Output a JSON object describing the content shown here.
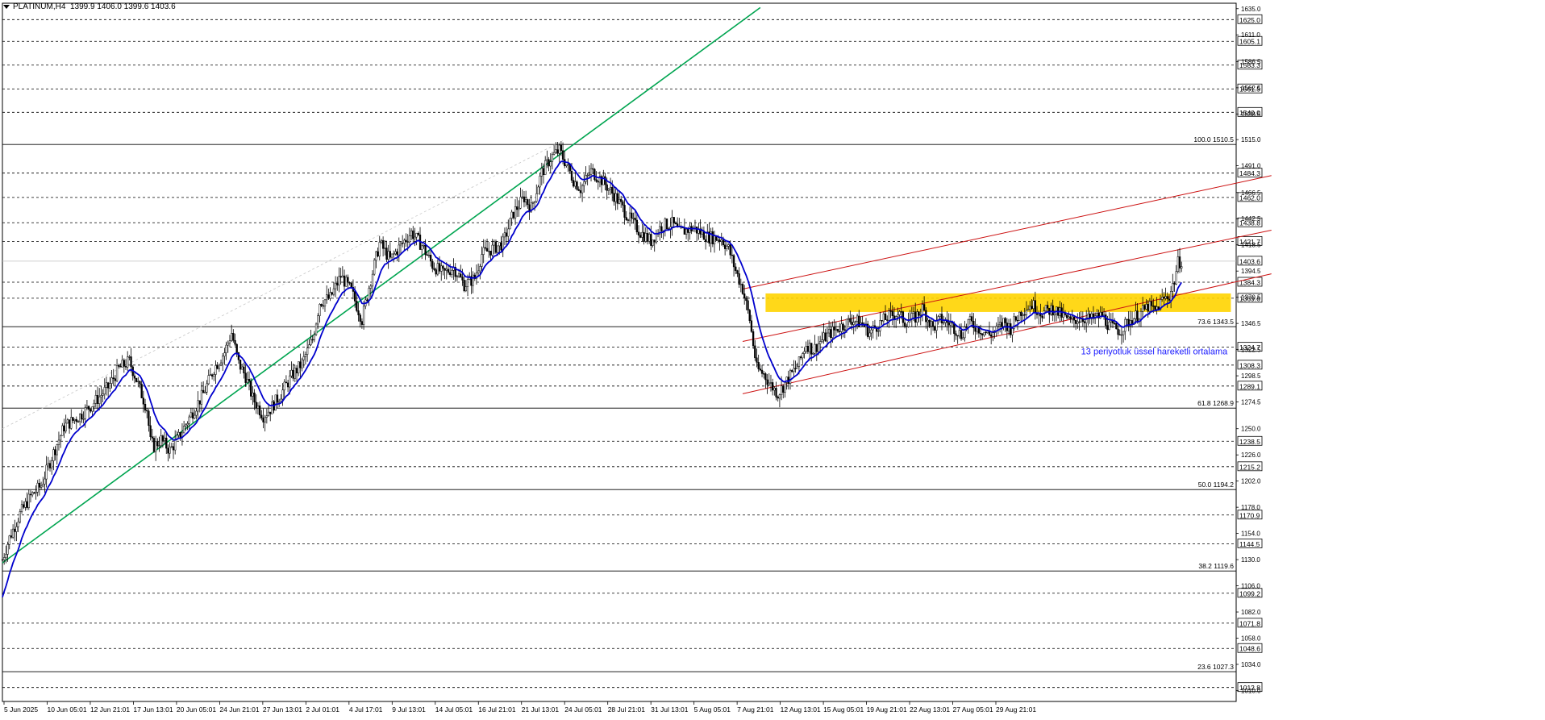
{
  "header": {
    "symbol": "PLATINUM,H4",
    "ohlc": "1399.9 1406.0 1399.6 1403.6"
  },
  "colors": {
    "background": "#ffffff",
    "candles": "#000000",
    "ema": "#0000cd",
    "support_trendline": "#00a550",
    "channel": "#cc1111",
    "zone": "#ffd400",
    "annotation": "#1a1aff",
    "grid": "#000000"
  },
  "chart_data": {
    "type": "candlestick",
    "title": "",
    "ylim": [
      1000,
      1640
    ],
    "x_ticks": [
      "5 Jun 2025",
      "10 Jun 05:01",
      "12 Jun 21:01",
      "17 Jun 13:01",
      "20 Jun 05:01",
      "24 Jun 21:01",
      "27 Jun 13:01",
      "2 Jul 01:01",
      "4 Jul 17:01",
      "9 Jul 13:01",
      "14 Jul 05:01",
      "16 Jul 21:01",
      "21 Jul 13:01",
      "24 Jul 05:01",
      "28 Jul 21:01",
      "31 Jul 13:01",
      "5 Aug 05:01",
      "7 Aug 21:01",
      "12 Aug 13:01",
      "15 Aug 05:01",
      "19 Aug 21:01",
      "22 Aug 13:01",
      "27 Aug 05:01",
      "29 Aug 21:01"
    ],
    "y_ticks": [
      "1635.0",
      "1611.0",
      "1586.5",
      "1562.5",
      "1538.5",
      "1515.0",
      "1491.0",
      "1466.5",
      "1442.5",
      "1418.5",
      "1394.5",
      "1370.5",
      "1346.5",
      "1322.5",
      "1298.5",
      "1274.5",
      "1250.0",
      "1226.0",
      "1202.0",
      "1178.0",
      "1154.0",
      "1130.0",
      "1106.0",
      "1082.0",
      "1058.0",
      "1034.0",
      "1010.0"
    ],
    "level_lines": [
      {
        "label": "1625.0",
        "value": 1625.0
      },
      {
        "label": "1605.1",
        "value": 1605.1
      },
      {
        "label": "1583.3",
        "value": 1583.3
      },
      {
        "label": "1561.5",
        "value": 1561.5
      },
      {
        "label": "1540.0",
        "value": 1540.0
      },
      {
        "label": "1484.3",
        "value": 1484.3
      },
      {
        "label": "1462.0",
        "value": 1462.0
      },
      {
        "label": "1438.8",
        "value": 1438.8
      },
      {
        "label": "1421.7",
        "value": 1421.7
      },
      {
        "label": "1384.3",
        "value": 1384.3
      },
      {
        "label": "1369.6",
        "value": 1369.6
      },
      {
        "label": "1324.7",
        "value": 1324.7
      },
      {
        "label": "1308.3",
        "value": 1308.3
      },
      {
        "label": "1289.1",
        "value": 1289.1
      },
      {
        "label": "1238.5",
        "value": 1238.5
      },
      {
        "label": "1215.2",
        "value": 1215.2
      },
      {
        "label": "1170.9",
        "value": 1170.9
      },
      {
        "label": "1144.5",
        "value": 1144.5
      },
      {
        "label": "1099.2",
        "value": 1099.2
      },
      {
        "label": "1071.8",
        "value": 1071.8
      },
      {
        "label": "1048.6",
        "value": 1048.6
      },
      {
        "label": "1012.8",
        "value": 1012.8
      }
    ],
    "current_price": {
      "label": "1403.6",
      "value": 1403.6
    },
    "fibonacci": [
      {
        "label": "100.0 1510.5",
        "value": 1510.5
      },
      {
        "label": "73.6 1343.5",
        "value": 1343.5
      },
      {
        "label": "61.8 1268.9",
        "value": 1268.9
      },
      {
        "label": "50.0 1194.2",
        "value": 1194.2
      },
      {
        "label": "38.2 1119.6",
        "value": 1119.6
      },
      {
        "label": "23.6 1027.3",
        "value": 1027.3
      }
    ],
    "series": [
      {
        "name": "13 periyotluk üssel hareketli ortalama",
        "type": "ema",
        "period": 13
      }
    ],
    "candles_close_path": [
      [
        0,
        1130
      ],
      [
        4,
        1150
      ],
      [
        10,
        1172
      ],
      [
        16,
        1188
      ],
      [
        22,
        1198
      ],
      [
        28,
        1224
      ],
      [
        35,
        1252
      ],
      [
        44,
        1262
      ],
      [
        52,
        1274
      ],
      [
        60,
        1288
      ],
      [
        66,
        1305
      ],
      [
        72,
        1312
      ],
      [
        76,
        1295
      ],
      [
        82,
        1268
      ],
      [
        84,
        1238
      ],
      [
        86,
        1234
      ],
      [
        90,
        1240
      ],
      [
        95,
        1230
      ],
      [
        100,
        1242
      ],
      [
        106,
        1260
      ],
      [
        114,
        1282
      ],
      [
        120,
        1305
      ],
      [
        126,
        1320
      ],
      [
        130,
        1338
      ],
      [
        134,
        1310
      ],
      [
        138,
        1298
      ],
      [
        142,
        1278
      ],
      [
        148,
        1262
      ],
      [
        152,
        1268
      ],
      [
        158,
        1282
      ],
      [
        164,
        1298
      ],
      [
        170,
        1310
      ],
      [
        176,
        1332
      ],
      [
        180,
        1366
      ],
      [
        186,
        1370
      ],
      [
        192,
        1390
      ],
      [
        198,
        1376
      ],
      [
        204,
        1350
      ],
      [
        208,
        1380
      ],
      [
        214,
        1420
      ],
      [
        220,
        1405
      ],
      [
        226,
        1418
      ],
      [
        232,
        1430
      ],
      [
        238,
        1418
      ],
      [
        244,
        1400
      ],
      [
        250,
        1392
      ],
      [
        256,
        1398
      ],
      [
        262,
        1382
      ],
      [
        268,
        1388
      ],
      [
        272,
        1410
      ],
      [
        278,
        1415
      ],
      [
        284,
        1420
      ],
      [
        290,
        1448
      ],
      [
        296,
        1462
      ],
      [
        300,
        1452
      ],
      [
        306,
        1485
      ],
      [
        312,
        1500
      ],
      [
        316,
        1505
      ],
      [
        320,
        1492
      ],
      [
        324,
        1478
      ],
      [
        328,
        1470
      ],
      [
        334,
        1486
      ],
      [
        340,
        1478
      ],
      [
        348,
        1462
      ],
      [
        356,
        1442
      ],
      [
        362,
        1430
      ],
      [
        368,
        1422
      ],
      [
        374,
        1436
      ],
      [
        380,
        1438
      ],
      [
        384,
        1430
      ],
      [
        392,
        1434
      ],
      [
        400,
        1426
      ],
      [
        408,
        1424
      ],
      [
        412,
        1415
      ],
      [
        416,
        1395
      ],
      [
        420,
        1378
      ],
      [
        424,
        1350
      ],
      [
        428,
        1305
      ],
      [
        432,
        1300
      ],
      [
        436,
        1290
      ],
      [
        440,
        1282
      ],
      [
        446,
        1296
      ],
      [
        452,
        1310
      ],
      [
        456,
        1328
      ],
      [
        460,
        1322
      ],
      [
        464,
        1330
      ],
      [
        470,
        1338
      ],
      [
        476,
        1344
      ],
      [
        482,
        1350
      ],
      [
        488,
        1346
      ],
      [
        492,
        1338
      ],
      [
        496,
        1344
      ],
      [
        502,
        1352
      ],
      [
        508,
        1356
      ],
      [
        512,
        1348
      ],
      [
        518,
        1352
      ],
      [
        522,
        1360
      ],
      [
        528,
        1342
      ],
      [
        532,
        1350
      ],
      [
        538,
        1346
      ],
      [
        544,
        1336
      ],
      [
        548,
        1348
      ],
      [
        554,
        1342
      ],
      [
        560,
        1336
      ],
      [
        564,
        1340
      ],
      [
        568,
        1348
      ],
      [
        572,
        1342
      ],
      [
        578,
        1358
      ],
      [
        584,
        1364
      ],
      [
        590,
        1356
      ],
      [
        596,
        1360
      ],
      [
        600,
        1355
      ],
      [
        606,
        1348
      ],
      [
        612,
        1352
      ],
      [
        618,
        1350
      ],
      [
        624,
        1354
      ],
      [
        628,
        1344
      ],
      [
        634,
        1340
      ],
      [
        640,
        1350
      ],
      [
        646,
        1356
      ],
      [
        650,
        1362
      ],
      [
        654,
        1358
      ],
      [
        658,
        1368
      ],
      [
        662,
        1372
      ],
      [
        665,
        1386
      ],
      [
        667,
        1402
      ],
      [
        669,
        1404
      ]
    ],
    "channel_lines": [
      {
        "from": [
          420,
          1282
        ],
        "to": [
          720,
          1392
        ]
      },
      {
        "from": [
          420,
          1330
        ],
        "to": [
          720,
          1432
        ]
      },
      {
        "from": [
          420,
          1378
        ],
        "to": [
          720,
          1482
        ]
      }
    ],
    "support_line": {
      "from": [
        0,
        1127
      ],
      "to": [
        430,
        1636
      ]
    },
    "zone": {
      "from_x": 433,
      "to_x": 697,
      "low": 1357,
      "high": 1374
    },
    "annotation": {
      "text": "13 periyotluk üssel hareketli ortalama"
    }
  }
}
